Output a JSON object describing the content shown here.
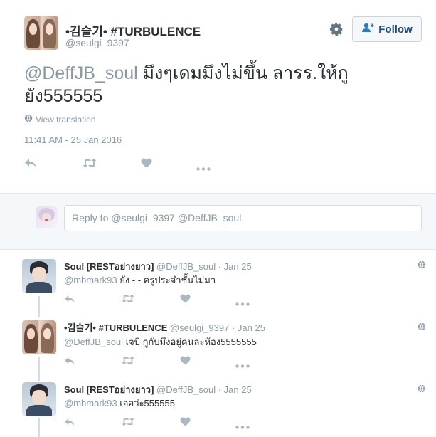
{
  "tweet": {
    "author_name": "•김슬기• #TURBULENCE",
    "author_handle": "@seulgi_9397",
    "follow_label": "Follow",
    "text_mention": "@DeffJB_soul",
    "text_line1": " มึงๆเดมมึงไม่ขึ้น ลารร.ให้กู",
    "text_line2": "ยัง555555",
    "view_translation": "View translation",
    "timestamp": "11:41 AM - 25 Jan 2016"
  },
  "reply_box": {
    "placeholder": "Reply to @seulgi_9397 @DeffJB_soul"
  },
  "replies": [
    {
      "name": "Soul [RESTอย่างยาว]",
      "handle": "@DeffJB_soul",
      "date": "· Jan 25",
      "mention": "@mbmark93",
      "text": " ยัง - - ครูประจำชั้นไม่มา"
    },
    {
      "name": "•김슬기• #TURBULENCE",
      "handle": "@seulgi_9397",
      "date": "· Jan 25",
      "mention": "@DeffJB_soul",
      "text": " เจบี กูกับมึงอยู่คนละห้อง5555555"
    },
    {
      "name": "Soul [RESTอย่างยาว]",
      "handle": "@DeffJB_soul",
      "date": "· Jan 25",
      "mention": "@mbmark93",
      "text": " เออว่ะ555555"
    }
  ],
  "colors": {
    "muted": "#8899a6",
    "text": "#292f33",
    "follow_text": "#1a4a7a",
    "divider": "#e1e8ed"
  },
  "icons": [
    "gear-icon",
    "follow-user-icon",
    "globe-icon",
    "reply-icon",
    "retweet-icon",
    "like-icon",
    "more-icon"
  ]
}
